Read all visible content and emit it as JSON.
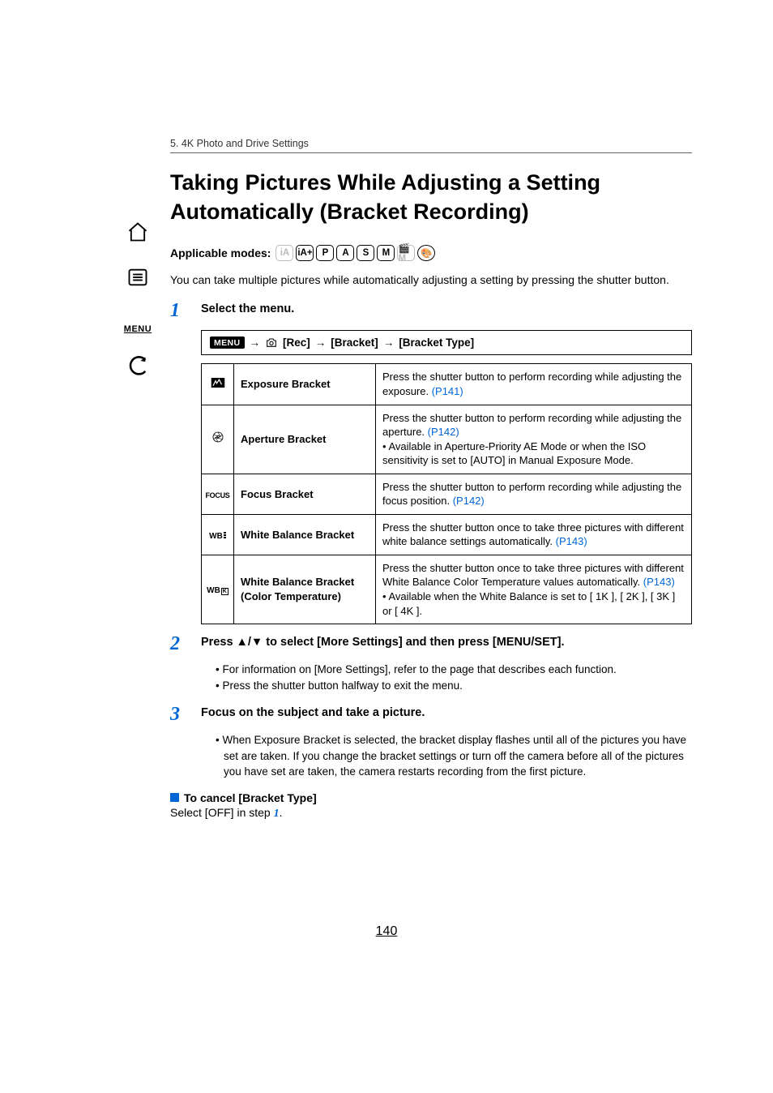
{
  "breadcrumb": "5. 4K Photo and Drive Settings",
  "title": "Taking Pictures While Adjusting a Setting Automatically (Bracket Recording)",
  "applicable_label": "Applicable modes:",
  "modes": [
    {
      "label": "iA",
      "dim": true,
      "round": false
    },
    {
      "label": "iA+",
      "dim": false,
      "round": false
    },
    {
      "label": "P",
      "dim": false,
      "round": false
    },
    {
      "label": "A",
      "dim": false,
      "round": false
    },
    {
      "label": "S",
      "dim": false,
      "round": false
    },
    {
      "label": "M",
      "dim": false,
      "round": false
    },
    {
      "label": "🎬M",
      "dim": true,
      "round": false
    },
    {
      "label": "🎨",
      "dim": false,
      "round": true
    }
  ],
  "intro": "You can take multiple pictures while automatically adjusting a setting by pressing the shutter button.",
  "step1": {
    "num": "1",
    "title": "Select the menu."
  },
  "menu_path": {
    "menu_chip": "MENU",
    "arrow1": "→",
    "rec": "[Rec]",
    "arrow2": "→",
    "bracket": "[Bracket]",
    "arrow3": "→",
    "bracket_type": "[Bracket Type]"
  },
  "table": [
    {
      "icon": "ev",
      "name": "Exposure Bracket",
      "desc_before": "Press the shutter button to perform recording while adjusting the exposure. ",
      "link": "(P141)",
      "desc_after": ""
    },
    {
      "icon": "aperture",
      "name": "Aperture Bracket",
      "desc_before": "Press the shutter button to perform recording while adjusting the aperture. ",
      "link": "(P142)",
      "desc_after": "\n• Available in Aperture-Priority AE Mode or when the ISO sensitivity is set to [AUTO] in Manual Exposure Mode."
    },
    {
      "icon": "focus",
      "name": "Focus Bracket",
      "desc_before": "Press the shutter button to perform recording while adjusting the focus position. ",
      "link": "(P142)",
      "desc_after": ""
    },
    {
      "icon": "wb",
      "name": "White Balance Bracket",
      "desc_before": "Press the shutter button once to take three pictures with different white balance settings automatically. ",
      "link": "(P143)",
      "desc_after": ""
    },
    {
      "icon": "wbk",
      "name": "White Balance Bracket (Color Temperature)",
      "desc_before": "Press the shutter button once to take three pictures with different White Balance Color Temperature values automatically. ",
      "link": "(P143)",
      "desc_after": "\n• Available when the White Balance is set to [ 1K ], [ 2K ], [ 3K ] or [ 4K ]."
    }
  ],
  "step2": {
    "num": "2",
    "title": "Press ▲/▼ to select [More Settings] and then press [MENU/SET].",
    "bullets": [
      "For information on [More Settings], refer to the page that describes each function.",
      "Press the shutter button halfway to exit the menu."
    ]
  },
  "step3": {
    "num": "3",
    "title": "Focus on the subject and take a picture.",
    "bullets": [
      "When Exposure Bracket is selected, the bracket display flashes until all of the pictures you have set are taken. If you change the bracket settings or turn off the camera before all of the pictures you have set are taken, the camera restarts recording from the first picture."
    ]
  },
  "cancel": {
    "heading": "To cancel [Bracket Type]",
    "body_before": "Select [OFF] in step ",
    "step_ref": "1",
    "body_after": "."
  },
  "sidebar": {
    "menu_label": "MENU"
  },
  "page_number": "140"
}
